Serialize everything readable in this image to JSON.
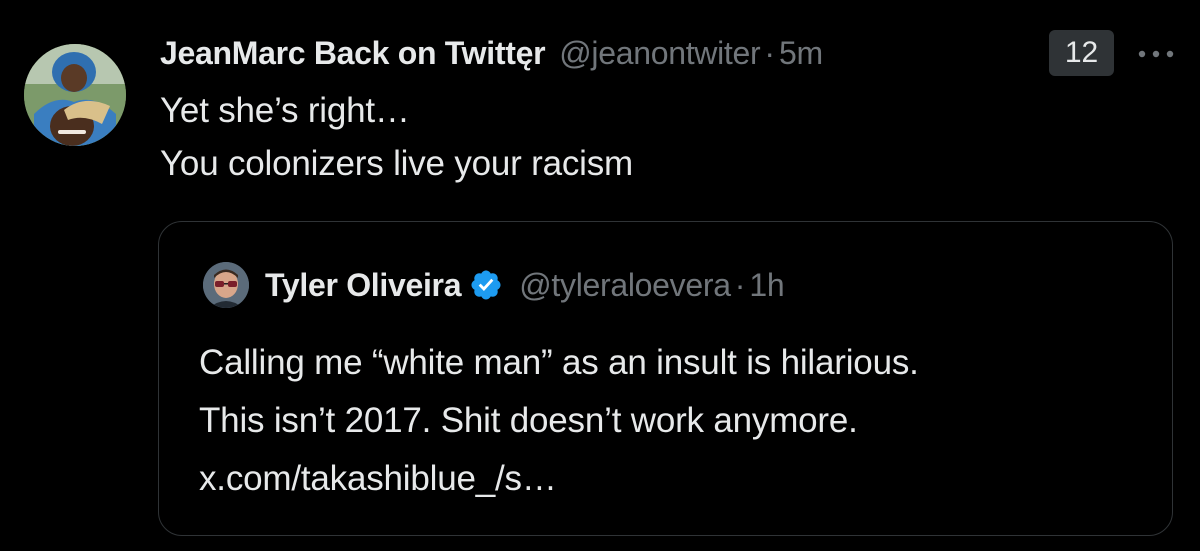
{
  "tweet": {
    "display_name": "JeanMarc Back on Twittęr",
    "handle": "@jeanontwiter",
    "separator": "·",
    "time": "5m",
    "badge_count": "12",
    "more_icon": "ellipsis-icon",
    "lines": [
      "Yet she’s right…",
      "You colonizers live your racism"
    ]
  },
  "quote": {
    "display_name": "Tyler Oliveira",
    "verified_icon": "verified-badge-icon",
    "verified_color": "#1d9bf0",
    "handle": "@tyleraloevera",
    "separator": "·",
    "time": "1h",
    "lines": [
      "Calling me “white man” as an insult is hilarious.",
      "This isn’t 2017. Shit doesn’t work anymore.",
      "x.com/takashiblue_/s…"
    ]
  },
  "colors": {
    "background": "#000000",
    "primary_text": "#e7e9ea",
    "secondary_text": "#71767b",
    "border": "#2f3336"
  }
}
